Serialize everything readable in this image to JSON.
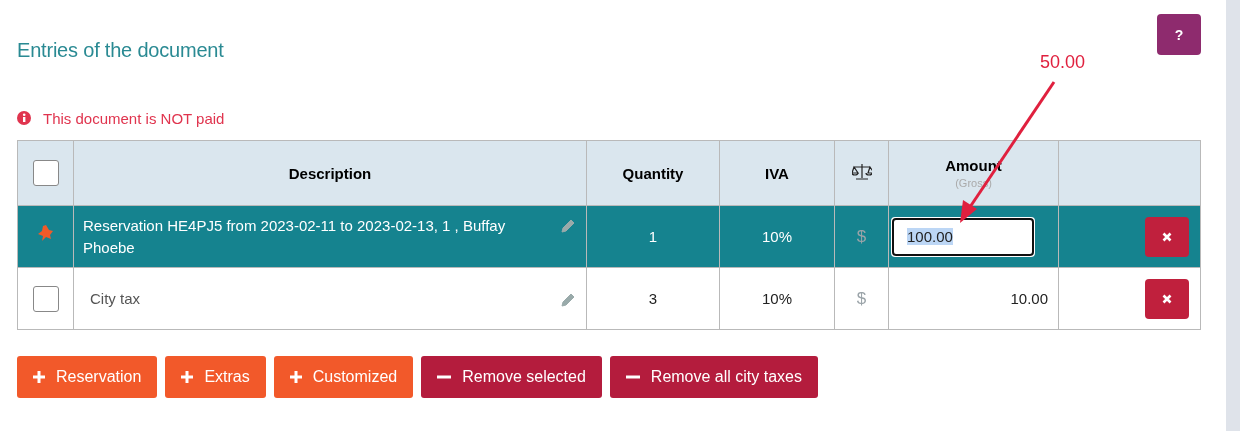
{
  "help_button": {
    "label": "?"
  },
  "title": "Entries of the document",
  "notice": {
    "text": "This document is NOT paid"
  },
  "table": {
    "header_checkbox": {
      "checked": false
    },
    "columns": [
      {
        "kind": "check"
      },
      {
        "kind": "text",
        "label": "Description"
      },
      {
        "kind": "text",
        "label": "Quantity"
      },
      {
        "kind": "text",
        "label": "IVA"
      },
      {
        "kind": "scale"
      },
      {
        "kind": "text",
        "label": "Amount",
        "sublabel": "(Gross)"
      },
      {
        "kind": "empty"
      }
    ],
    "rows": [
      {
        "kind": "reservation",
        "selected": true,
        "description": "Reservation HE4PJ5 from 2023-02-11 to 2023-02-13, 1 , Buffay Phoebe",
        "quantity": "1",
        "iva": "10%",
        "currency": "$",
        "amount": "100.00",
        "editing": true
      },
      {
        "kind": "tax",
        "checked": false,
        "selected": false,
        "description": "City tax",
        "quantity": "3",
        "iva": "10%",
        "currency": "$",
        "amount": "10.00",
        "editing": false
      }
    ]
  },
  "buttons": [
    {
      "kind": "add",
      "label": "Reservation"
    },
    {
      "kind": "add",
      "label": "Extras"
    },
    {
      "kind": "add",
      "label": "Customized"
    },
    {
      "kind": "remove",
      "label": "Remove selected"
    },
    {
      "kind": "remove",
      "label": "Remove all city taxes"
    }
  ],
  "annotation": {
    "text": "50.00"
  }
}
